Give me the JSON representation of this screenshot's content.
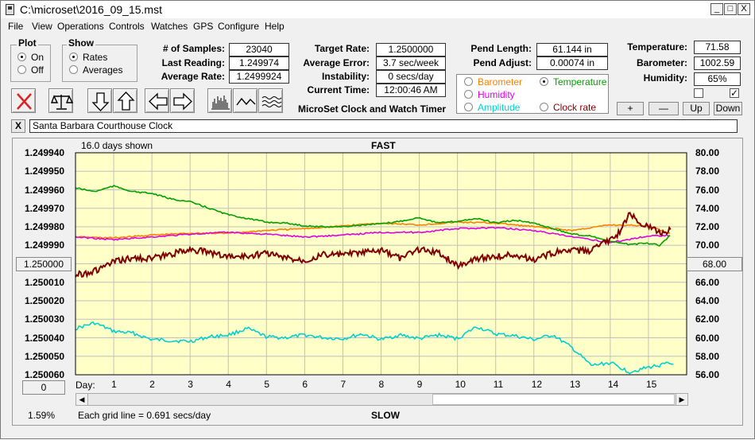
{
  "window": {
    "title": "C:\\microset\\2016_09_15.mst",
    "minimize": "_",
    "restore": "□",
    "close": "X"
  },
  "menu": [
    "File",
    "View",
    "Operations",
    "Controls",
    "Watches",
    "GPS",
    "Configure",
    "Help"
  ],
  "plot_group": {
    "title": "Plot",
    "on": "On",
    "off": "Off",
    "selected": "On"
  },
  "show_group": {
    "title": "Show",
    "rates": "Rates",
    "averages": "Averages",
    "selected": "Rates"
  },
  "stats": {
    "samples_label": "# of Samples:",
    "samples": "23040",
    "last_label": "Last Reading:",
    "last": "1.249974",
    "avg_label": "Average Rate:",
    "avg": "1.2499924"
  },
  "targets": {
    "target_label": "Target Rate:",
    "target": "1.2500000",
    "avgerr_label": "Average Error:",
    "avgerr": "3.7 sec/week",
    "instab_label": "Instability:",
    "instab": "0 secs/day",
    "time_label": "Current Time:",
    "time": "12:00:46 AM",
    "app_name": "MicroSet Clock and Watch Timer"
  },
  "pend": {
    "length_label": "Pend Length:",
    "length": "61.144 in",
    "adjust_label": "Pend Adjust:",
    "adjust": "0.00074 in"
  },
  "right_axis_select": {
    "barometer": "Barometer",
    "temperature": "Temperature",
    "humidity": "Humidity",
    "amplitude": "Amplitude",
    "clockrate": "Clock rate",
    "selected": "Temperature",
    "colors": {
      "barometer": "#ff8000",
      "temperature": "#00a000",
      "humidity": "#e000e0",
      "amplitude": "#00d0d0",
      "clockrate": "#800000"
    }
  },
  "env": {
    "temp_label": "Temperature:",
    "temp": "71.58",
    "baro_label": "Barometer:",
    "baro": "1002.59",
    "hum_label": "Humidity:",
    "hum": "65%"
  },
  "scale_buttons": {
    "plus": "+",
    "minus": "—",
    "up": "Up",
    "down": "Down"
  },
  "clock_name": "Santa Barbara Courthouse Clock",
  "clear_button": "X",
  "chart_data": {
    "type": "line",
    "top_label": "FAST",
    "bottom_label": "SLOW",
    "days_shown": "16.0 days shown",
    "grid_note": "Each grid line = 0.691 secs/day",
    "day_label": "Day:",
    "left_axis": {
      "ticks": [
        "1.249940",
        "1.249950",
        "1.249960",
        "1.249970",
        "1.249980",
        "1.249990",
        "1.250000",
        "1.250010",
        "1.250020",
        "1.250030",
        "1.250040",
        "1.250050",
        "1.250060"
      ],
      "highlight": "1.250000",
      "ylim": [
        1.24994,
        1.25006
      ],
      "inverted": true
    },
    "right_axis": {
      "ticks": [
        "80.00",
        "78.00",
        "76.00",
        "74.00",
        "72.00",
        "70.00",
        "68.00",
        "66.00",
        "64.00",
        "62.00",
        "60.00",
        "58.00",
        "56.00"
      ],
      "highlight": "68.00",
      "ylim": [
        56,
        80
      ]
    },
    "x_ticks": [
      "1",
      "2",
      "3",
      "4",
      "5",
      "6",
      "7",
      "8",
      "9",
      "10",
      "11",
      "12",
      "13",
      "14",
      "15"
    ],
    "xlim": [
      0,
      16
    ],
    "background": "#ffffc8",
    "scroll_left_value": "0",
    "zoom_percent": "1.59%",
    "series": [
      {
        "name": "Clock rate",
        "axis": "left",
        "color": "#800000",
        "x": [
          0,
          0.5,
          1,
          1.5,
          2,
          2.5,
          3,
          3.5,
          4,
          4.5,
          5,
          5.5,
          6,
          6.5,
          7,
          7.5,
          8,
          8.5,
          9,
          9.5,
          10,
          10.5,
          11,
          11.5,
          12,
          12.5,
          13,
          13.5,
          14,
          14.2,
          14.5,
          14.8,
          15,
          15.3,
          15.6
        ],
        "y": [
          1.250006,
          1.250004,
          1.249999,
          1.249997,
          1.249997,
          1.249995,
          1.249992,
          1.249994,
          1.249996,
          1.249996,
          1.249994,
          1.249997,
          1.249998,
          1.249995,
          1.249995,
          1.249994,
          1.249993,
          1.249997,
          1.249992,
          1.249994,
          1.250001,
          1.249997,
          1.249996,
          1.249995,
          1.249998,
          1.249994,
          1.249993,
          1.249993,
          1.249987,
          1.249984,
          1.249973,
          1.249978,
          1.24998,
          1.249983,
          1.249982
        ]
      },
      {
        "name": "Temperature",
        "axis": "right",
        "color": "#00a000",
        "x": [
          0,
          0.5,
          1,
          1.5,
          2,
          2.5,
          3,
          3.5,
          4,
          4.5,
          5,
          5.5,
          6,
          6.5,
          7,
          7.5,
          8,
          8.5,
          9,
          9.5,
          10,
          10.5,
          11,
          11.5,
          12,
          12.5,
          13,
          13.5,
          14,
          14.5,
          15,
          15.3,
          15.6
        ],
        "y": [
          76.2,
          75.8,
          76.4,
          75.8,
          75.6,
          75.0,
          74.7,
          74.0,
          73.3,
          72.9,
          72.5,
          72.4,
          72.1,
          72.0,
          72.0,
          72.2,
          72.3,
          72.6,
          73.0,
          72.4,
          72.6,
          72.9,
          72.4,
          72.7,
          72.4,
          71.8,
          71.2,
          71.0,
          70.4,
          70.1,
          70.2,
          70.0,
          71.2
        ]
      },
      {
        "name": "Barometer",
        "axis": "right",
        "color": "#ff8000",
        "x": [
          0,
          1,
          2,
          3,
          4,
          5,
          6,
          7,
          8,
          9,
          10,
          11,
          12,
          13,
          14,
          15,
          15.6
        ],
        "y": [
          70.9,
          70.8,
          71.1,
          71.3,
          71.3,
          71.6,
          71.8,
          72.1,
          72.4,
          72.2,
          72.5,
          72.4,
          72.0,
          71.6,
          72.2,
          72.1,
          71.2
        ]
      },
      {
        "name": "Humidity",
        "axis": "right",
        "color": "#e000e0",
        "x": [
          0,
          1,
          2,
          3,
          4,
          5,
          6,
          7,
          8,
          9,
          10,
          11,
          12,
          13,
          14,
          15,
          15.6
        ],
        "y": [
          70.9,
          70.6,
          70.9,
          71.2,
          71.4,
          71.2,
          70.9,
          71.1,
          71.4,
          71.4,
          71.8,
          71.9,
          71.6,
          70.9,
          70.3,
          71.0,
          71.1
        ]
      },
      {
        "name": "Amplitude",
        "axis": "right",
        "color": "#00d0d0",
        "x": [
          0,
          0.5,
          1,
          1.5,
          2,
          2.5,
          3,
          3.5,
          4,
          4.5,
          5,
          5.5,
          6,
          6.5,
          7,
          7.5,
          8,
          8.5,
          9,
          9.5,
          10,
          10.5,
          11,
          11.5,
          12,
          12.5,
          13,
          13.5,
          14,
          14.5,
          15,
          15.5,
          15.7
        ],
        "y": [
          61.0,
          61.6,
          60.7,
          60.5,
          59.8,
          59.7,
          59.6,
          60.1,
          60.3,
          61.0,
          60.1,
          60.0,
          60.3,
          60.0,
          59.9,
          60.4,
          59.8,
          60.3,
          59.9,
          60.3,
          59.9,
          61.2,
          60.4,
          60.2,
          59.8,
          60.3,
          58.9,
          57.0,
          57.3,
          56.3,
          56.8,
          57.2,
          57.1
        ]
      }
    ]
  }
}
